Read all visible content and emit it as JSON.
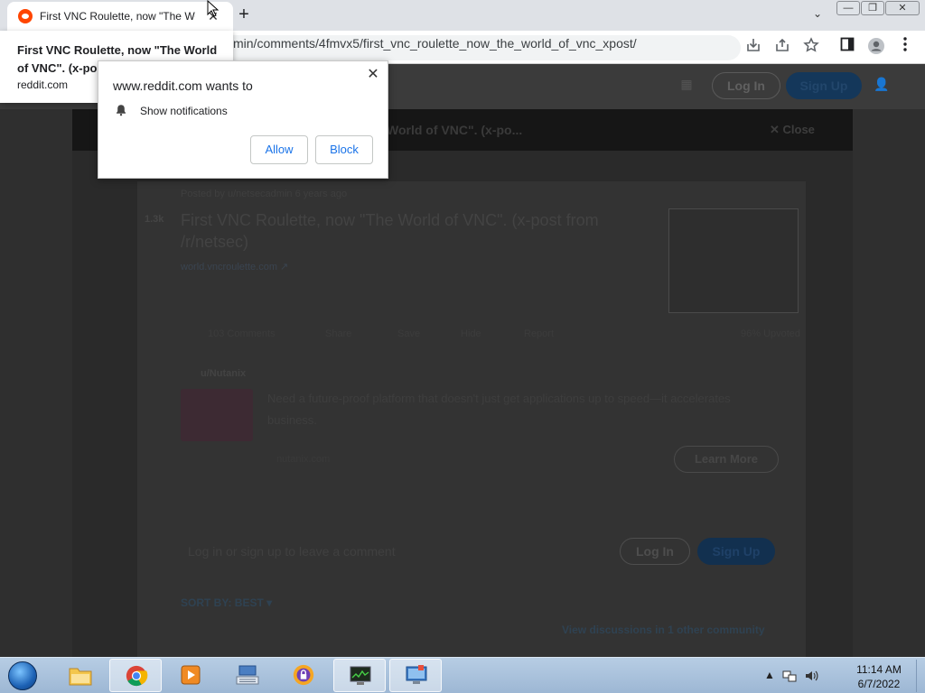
{
  "browser": {
    "tab_title": "First VNC Roulette, now \"The World of VNC\". (x-post from /r/netsec)",
    "tab_close": "✕",
    "new_tab": "+",
    "tab_dropdown": "⌄",
    "url_visible": "min/comments/4fmvx5/first_vnc_roulette_now_the_world_of_vnc_xpost/",
    "window_controls": {
      "minimize": "—",
      "maximize": "❐",
      "close": "✕"
    }
  },
  "tab_tooltip": {
    "title": "First VNC Roulette, now \"The World of VNC\". (x-post",
    "domain": "reddit.com"
  },
  "permission_prompt": {
    "title": "www.reddit.com wants to",
    "item": "Show notifications",
    "allow": "Allow",
    "block": "Block",
    "close": "✕"
  },
  "page": {
    "header": {
      "login": "Log In",
      "signup": "Sign Up"
    },
    "post_bar": {
      "title": "World of VNC\". (x-po...",
      "close": "✕ Close"
    },
    "post": {
      "meta": "Posted by u/netsecadmin 6 years ago",
      "votes": "1.3k",
      "title": "First VNC Roulette, now \"The World of VNC\". (x-post from /r/netsec)",
      "domain": "world.vncroulette.com ↗",
      "actions": [
        "103 Comments",
        "Share",
        "Save",
        "Hide",
        "Report"
      ],
      "upvoted": "96% Upvoted"
    },
    "ad": {
      "user": "u/Nutanix",
      "promoted": "· Promoted",
      "text": "Need a future-proof platform that doesn't just get applications up to speed—it accelerates business.",
      "domain": "nutanix.com",
      "cta": "Learn More"
    },
    "comment_prompt": "Log in or sign up to leave a comment",
    "comment_login": "Log In",
    "comment_signup": "Sign Up",
    "sort_by": "SORT BY: BEST ▾",
    "view_discussions": "View discussions in 1 other community"
  },
  "taskbar": {
    "time": "11:14 AM",
    "date": "6/7/2022",
    "apps": [
      "windows-explorer",
      "google-chrome",
      "media-player",
      "keyboard-app",
      "security-app",
      "network-monitor",
      "remote-desktop"
    ]
  }
}
